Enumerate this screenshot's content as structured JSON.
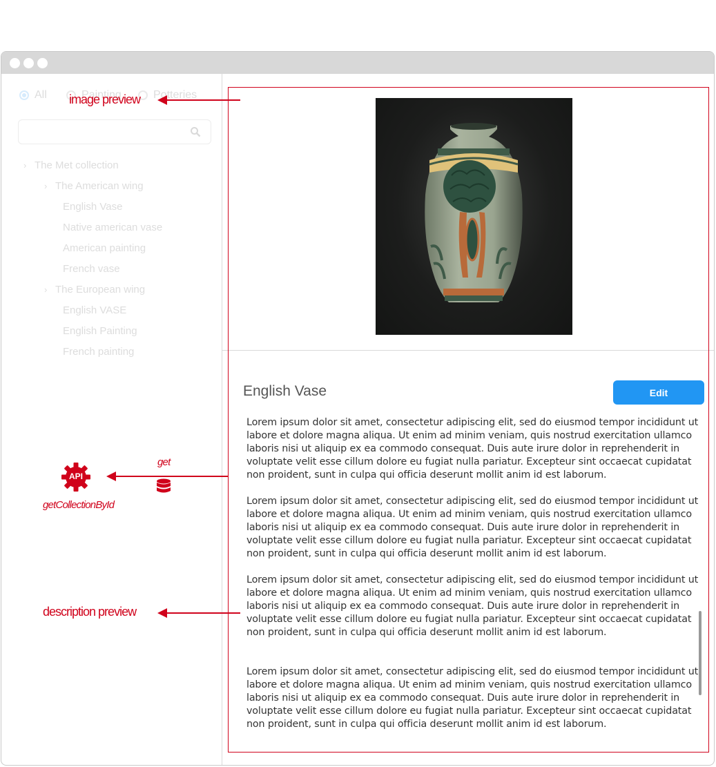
{
  "filters": {
    "options": [
      {
        "label": "All",
        "checked": true
      },
      {
        "label": "Painting",
        "checked": false
      },
      {
        "label": "Potteries",
        "checked": false
      }
    ]
  },
  "search": {
    "placeholder": ""
  },
  "tree": {
    "items": [
      {
        "label": "The Met collection",
        "has_chevron": true
      },
      {
        "label": "The American wing",
        "has_chevron": true
      },
      {
        "label": "English Vase",
        "has_chevron": false
      },
      {
        "label": "Native american vase",
        "has_chevron": false
      },
      {
        "label": "American painting",
        "has_chevron": false
      },
      {
        "label": "French vase",
        "has_chevron": false
      },
      {
        "label": "The European wing",
        "has_chevron": true
      },
      {
        "label": "English VASE",
        "has_chevron": false
      },
      {
        "label": "English Painting",
        "has_chevron": false
      },
      {
        "label": "French painting",
        "has_chevron": false
      }
    ]
  },
  "detail": {
    "title": "English Vase",
    "edit_label": "Edit",
    "paragraphs": [
      "Lorem ipsum dolor sit amet, consectetur adipiscing elit, sed do eiusmod tempor incididunt ut labore et dolore magna aliqua. Ut enim ad minim veniam, quis nostrud exercitation ullamco laboris nisi ut aliquip ex ea commodo consequat. Duis aute irure dolor in reprehenderit in voluptate velit esse cillum dolore eu fugiat nulla pariatur. Excepteur sint occaecat cupidatat non proident, sunt in culpa qui officia deserunt mollit anim id est laborum.",
      "Lorem ipsum dolor sit amet, consectetur adipiscing elit, sed do eiusmod tempor incididunt ut labore et dolore magna aliqua. Ut enim ad minim veniam, quis nostrud exercitation ullamco laboris nisi ut aliquip ex ea commodo consequat. Duis aute irure dolor in reprehenderit in voluptate velit esse cillum dolore eu fugiat nulla pariatur. Excepteur sint occaecat cupidatat non proident, sunt in culpa qui officia deserunt mollit anim id est laborum.",
      "Lorem ipsum dolor sit amet, consectetur adipiscing elit, sed do eiusmod tempor incididunt ut labore et dolore magna aliqua. Ut enim ad minim veniam, quis nostrud exercitation ullamco laboris nisi ut aliquip ex ea commodo consequat. Duis aute irure dolor in reprehenderit in voluptate velit esse cillum dolore eu fugiat nulla pariatur. Excepteur sint occaecat cupidatat non proident, sunt in culpa qui officia deserunt mollit anim id est laborum.",
      "Lorem ipsum dolor sit amet, consectetur adipiscing elit, sed do eiusmod tempor incididunt ut labore et dolore magna aliqua. Ut enim ad minim veniam, quis nostrud exercitation ullamco laboris nisi ut aliquip ex ea commodo consequat. Duis aute irure dolor in reprehenderit in voluptate velit esse cillum dolore eu fugiat nulla pariatur. Excepteur sint occaecat cupidatat non proident, sunt in culpa qui officia deserunt mollit anim id est laborum."
    ]
  },
  "annotations": {
    "image_preview": "image preview",
    "description_preview": "description preview",
    "get": "get",
    "api_badge": "API",
    "api_name": "getCollectionById"
  },
  "colors": {
    "accent": "#2196f3",
    "annotation": "#d0021b"
  }
}
